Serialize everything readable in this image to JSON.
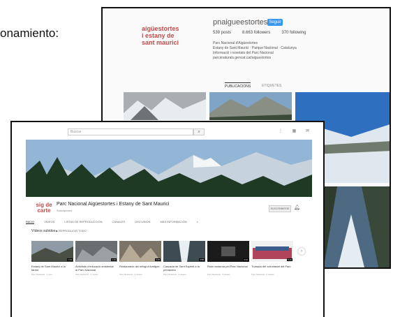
{
  "caption": "onamiento:",
  "instagram": {
    "logo_lines": [
      "aigüestortes",
      "i estany de",
      "sant maurici"
    ],
    "username": "pnaigueestortes",
    "follow_label": "Seguir",
    "stats": [
      "539 posts",
      "8.663 followers",
      "370 following"
    ],
    "bio_lines": [
      "Parc Nacional d'Aigüestortes",
      "Estany de Sant Maurici · Parque Nacional · Catalunya",
      "Informació i novetats del Parc Nacional",
      "parcsnaturals.gencat.cat/aiguestortes"
    ],
    "tabs": [
      "PUBLICACIONS",
      "ETIQUETES"
    ]
  },
  "youtube": {
    "search_placeholder": "Buscar",
    "top_icons": "⋮ ▦ ✉",
    "avatar_lines": [
      "sig de",
      "carte"
    ],
    "channel_name": "Parc Nacional Aigüestortes i Estany de Sant Maurici",
    "subscribers": "Suscriptores",
    "subscribe_label": "SUSCRIBIRSE",
    "nav_tabs": [
      "INICIO",
      "VÍDEOS",
      "LISTAS DE REPRODUCCIÓN",
      "CANALES",
      "DISCUSIÓN",
      "MÁS INFORMACIÓN"
    ],
    "section_title": "Vídeos subidos",
    "play_all": "▶ REPRODUCIR TODO",
    "videos": [
      {
        "title": "Estany de Sant Maurici a la tardor",
        "meta": "Parc Nacional · 1 mes",
        "duration": "1:24"
      },
      {
        "title": "Activitats d'educació ambiental al Parc Nacional",
        "meta": "Parc Nacional · 2 meses",
        "duration": "2:10"
      },
      {
        "title": "Restauració del refugi d'Amitges",
        "meta": "Parc Nacional · 3 meses",
        "duration": "4:05"
      },
      {
        "title": "Cascada de Sant Esperit a la primavera",
        "meta": "Parc Nacional · 4 meses",
        "duration": "0:58"
      },
      {
        "title": "Ruta nocturna pel Parc Nacional",
        "meta": "Parc Nacional · 5 meses",
        "duration": "3:12"
      },
      {
        "title": "Trobada del voluntariat del Parc",
        "meta": "Parc Nacional · 6 meses",
        "duration": "5:40"
      }
    ]
  }
}
